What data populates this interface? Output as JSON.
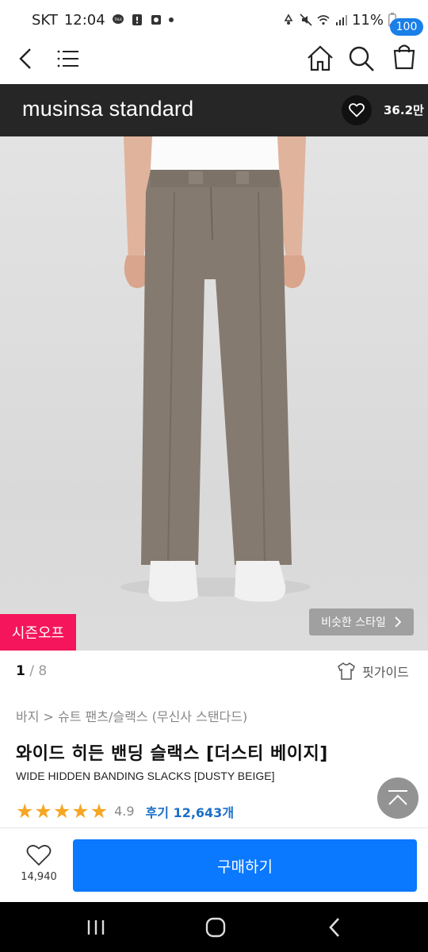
{
  "status_bar": {
    "carrier": "SKT",
    "time": "12:04",
    "battery": "11%",
    "colors": {
      "battery_low": "#e53935"
    }
  },
  "nav": {
    "cart_count": "100",
    "icons": [
      "back-arrow-icon",
      "menu-icon",
      "home-icon",
      "search-icon",
      "shopping-bag-icon"
    ]
  },
  "brand": {
    "name": "musinsa standard",
    "like_count": "36.2만"
  },
  "image_overlay": {
    "season_badge": "시즌오프",
    "similar_style": "비슷한 스타일"
  },
  "gallery": {
    "current": "1",
    "separator": "/",
    "total": "8",
    "fit_guide": "핏가이드"
  },
  "product": {
    "breadcrumb": "바지 > 슈트 팬츠/슬랙스 (무신사 스탠다드)",
    "title_ko": "와이드 히든 밴딩 슬랙스 [더스티 베이지]",
    "title_en": "WIDE HIDDEN BANDING SLACKS [DUSTY BEIGE]",
    "rating": "4.9",
    "stars": 5,
    "reviews": "후기 12,643개"
  },
  "bottom": {
    "like_count": "14,940",
    "buy_label": "구매하기"
  },
  "colors": {
    "accent_blue": "#0a78ff",
    "badge_pink": "#f5155d",
    "star_orange": "#f5a623",
    "review_blue": "#1a6fc9",
    "brand_bar": "#262626"
  }
}
